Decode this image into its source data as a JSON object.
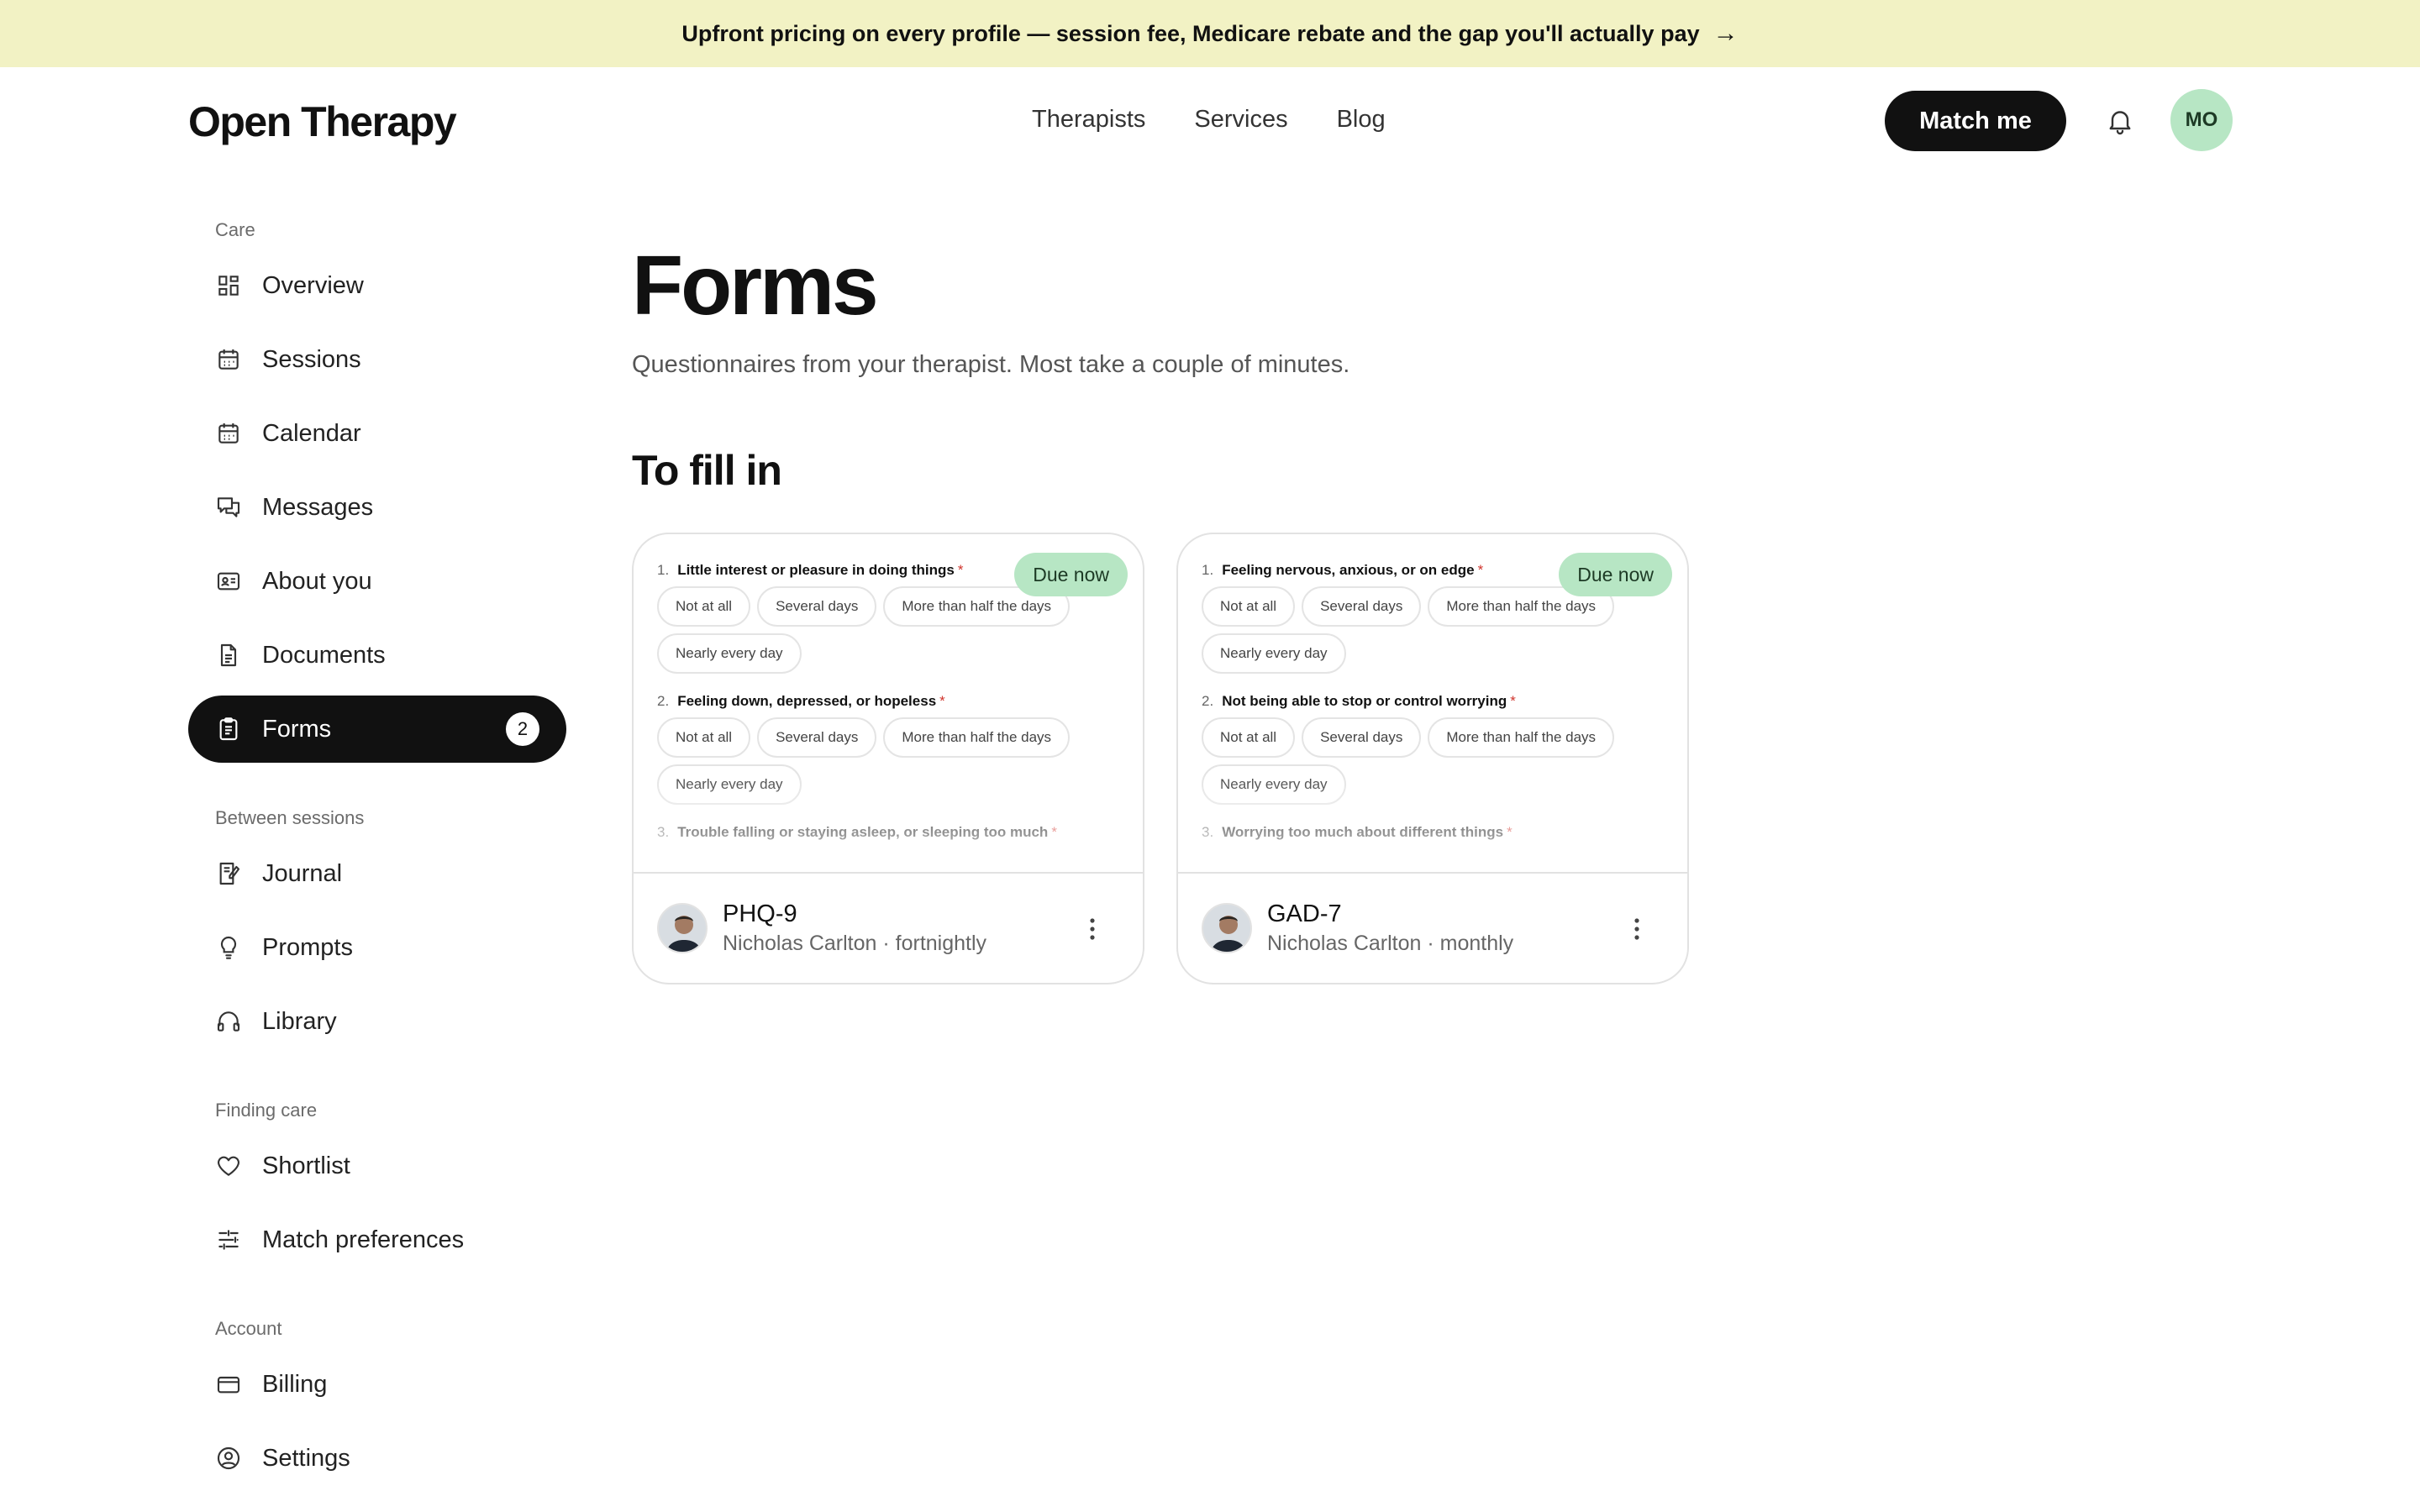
{
  "banner": {
    "text": "Upfront pricing on every profile — session fee, Medicare rebate and the gap you'll actually pay",
    "arrow": "→"
  },
  "header": {
    "logo": "Open Therapy",
    "nav": [
      "Therapists",
      "Services",
      "Blog"
    ],
    "cta": "Match me",
    "avatar_initials": "MO"
  },
  "sidebar": {
    "sections": [
      {
        "label": "Care",
        "items": [
          {
            "label": "Overview",
            "icon": "grid-icon"
          },
          {
            "label": "Sessions",
            "icon": "calendar-icon"
          },
          {
            "label": "Calendar",
            "icon": "calendar-icon"
          },
          {
            "label": "Messages",
            "icon": "chat-icon"
          },
          {
            "label": "About you",
            "icon": "id-card-icon"
          },
          {
            "label": "Documents",
            "icon": "document-icon"
          },
          {
            "label": "Forms",
            "icon": "clipboard-icon",
            "badge": "2",
            "active": true
          }
        ]
      },
      {
        "label": "Between sessions",
        "items": [
          {
            "label": "Journal",
            "icon": "journal-icon"
          },
          {
            "label": "Prompts",
            "icon": "lightbulb-icon"
          },
          {
            "label": "Library",
            "icon": "headphones-icon"
          }
        ]
      },
      {
        "label": "Finding care",
        "items": [
          {
            "label": "Shortlist",
            "icon": "heart-icon"
          },
          {
            "label": "Match preferences",
            "icon": "sliders-icon"
          }
        ]
      },
      {
        "label": "Account",
        "items": [
          {
            "label": "Billing",
            "icon": "credit-card-icon"
          },
          {
            "label": "Settings",
            "icon": "user-circle-icon"
          }
        ]
      }
    ]
  },
  "main": {
    "title": "Forms",
    "subtitle": "Questionnaires from your therapist. Most take a couple of minutes.",
    "section_title": "To fill in"
  },
  "cards": [
    {
      "badge": "Due now",
      "form_name": "PHQ-9",
      "therapist": "Nicholas Carlton",
      "frequency": "fortnightly",
      "questions": [
        {
          "num": "1.",
          "text": "Little interest or pleasure in doing things",
          "req": "*"
        },
        {
          "num": "2.",
          "text": "Feeling down, depressed, or hopeless",
          "req": "*"
        },
        {
          "num": "3.",
          "text": "Trouble falling or staying asleep, or sleeping too much",
          "req": "*"
        }
      ],
      "options": [
        "Not at all",
        "Several days",
        "More than half the days",
        "Nearly every day"
      ]
    },
    {
      "badge": "Due now",
      "form_name": "GAD-7",
      "therapist": "Nicholas Carlton",
      "frequency": "monthly",
      "questions": [
        {
          "num": "1.",
          "text": "Feeling nervous, anxious, or on edge",
          "req": "*"
        },
        {
          "num": "2.",
          "text": "Not being able to stop or control worrying",
          "req": "*"
        },
        {
          "num": "3.",
          "text": "Worrying too much about different things",
          "req": "*"
        }
      ],
      "options": [
        "Not at all",
        "Several days",
        "More than half the days",
        "Nearly every day"
      ]
    }
  ],
  "colors": {
    "banner_bg": "#f2f2c4",
    "accent_green": "#b7e6c4",
    "active_nav": "#111111",
    "required": "#d0342c"
  }
}
